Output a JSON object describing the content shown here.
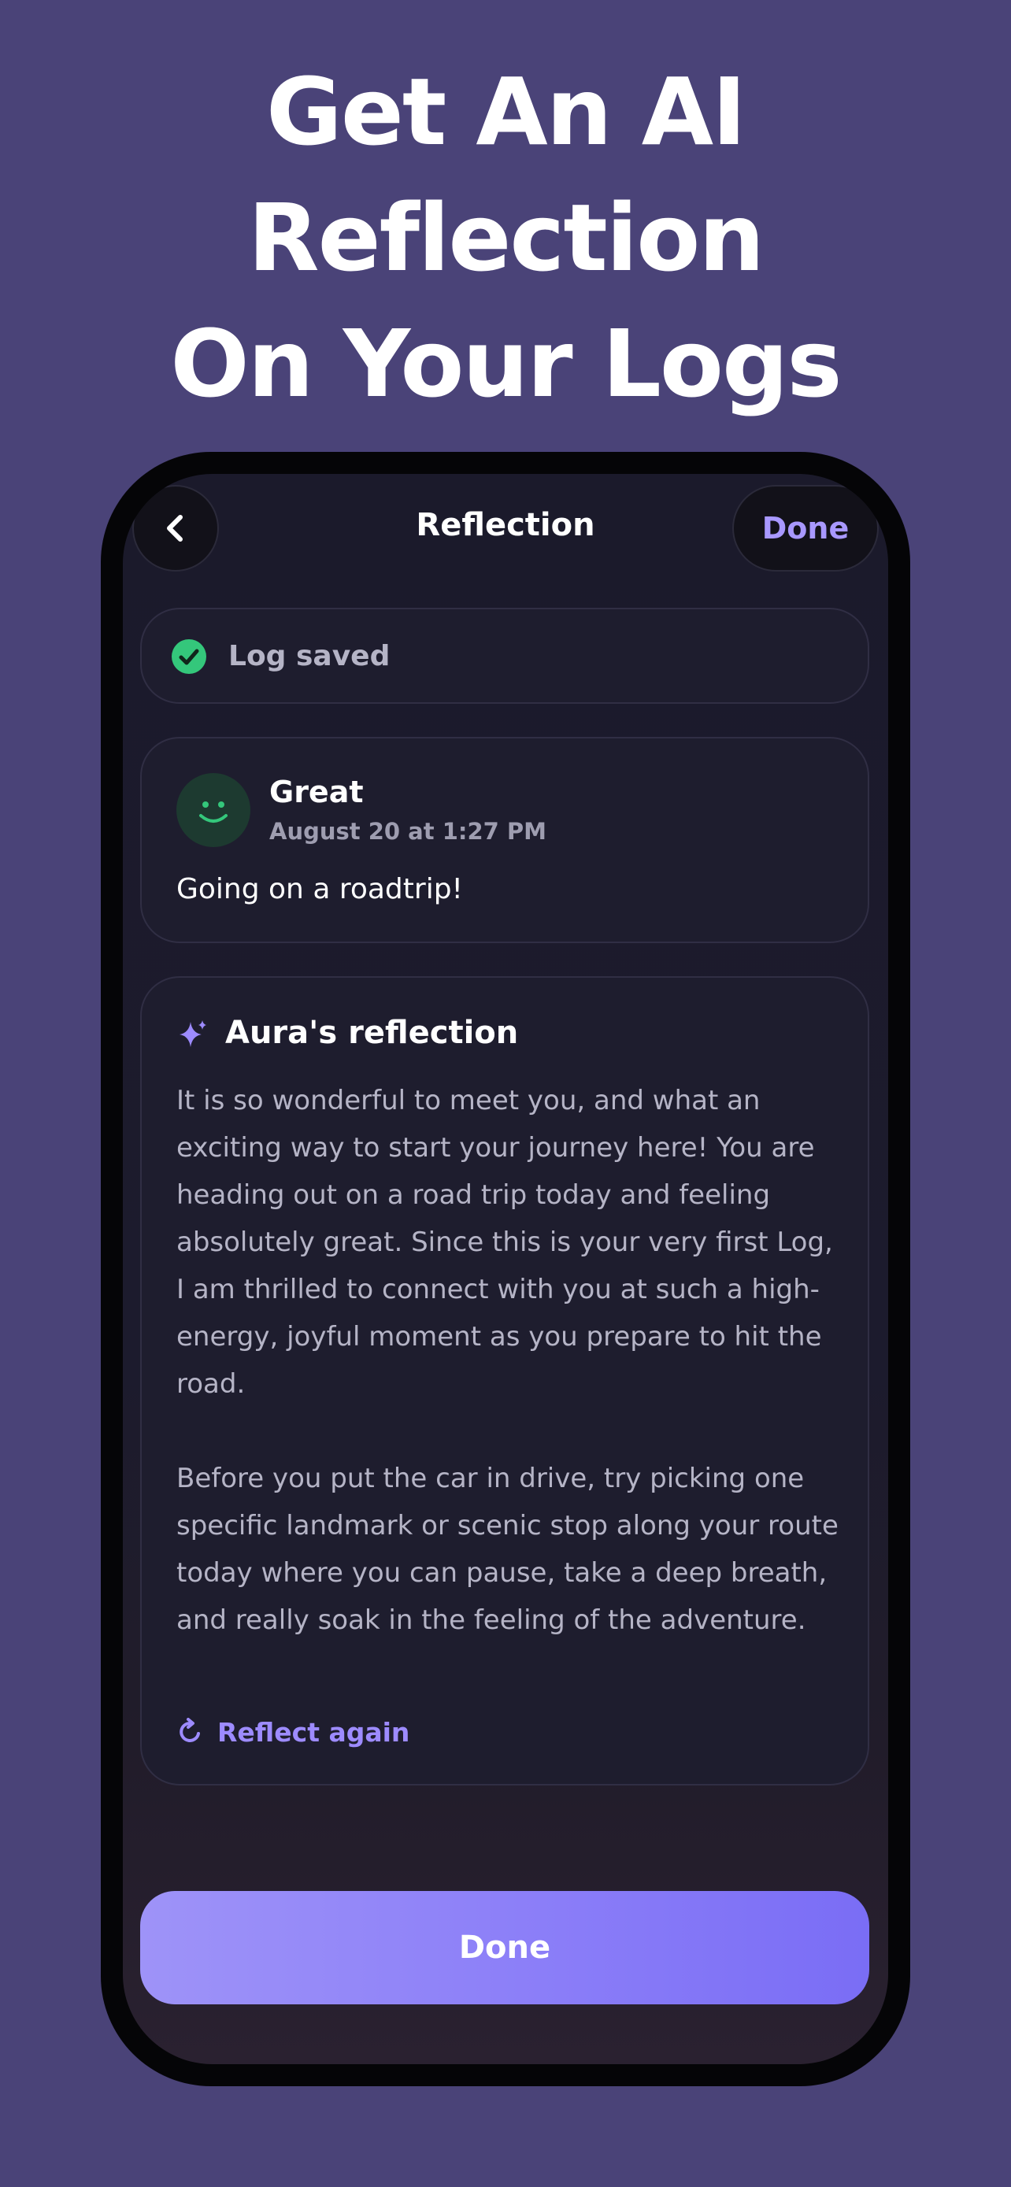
{
  "headline": {
    "line1": "Get An AI Reflection",
    "line2": "On Your Logs"
  },
  "nav": {
    "back_icon": "chevron-left-icon",
    "title": "Reflection",
    "done_label": "Done"
  },
  "saved_banner": {
    "icon": "check-circle-icon",
    "text": "Log saved"
  },
  "log_entry": {
    "mood_icon": "smiley-face-icon",
    "mood": "Great",
    "timestamp": "August 20 at 1:27 PM",
    "note": "Going on a roadtrip!"
  },
  "reflection": {
    "icon": "sparkle-icon",
    "title": "Aura's reflection",
    "paragraphs": [
      "It is so wonderful to meet you, and what an exciting way to start your journey here! You are heading out on a road trip today and feeling absolutely great. Since this is your very first Log, I am thrilled to connect with you at such a high-energy, joyful moment as you prepare to hit the road.",
      "Before you put the car in drive, try picking one specific landmark or scenic stop along your route today where you can pause, take a deep breath, and really soak in the feeling of the adventure."
    ],
    "reflect_again_icon": "refresh-icon",
    "reflect_again_label": "Reflect again"
  },
  "footer": {
    "done_label": "Done"
  },
  "colors": {
    "background": "#4a4378",
    "accent": "#9d8bff",
    "success": "#34c77b",
    "card": "#1e1d2e"
  }
}
